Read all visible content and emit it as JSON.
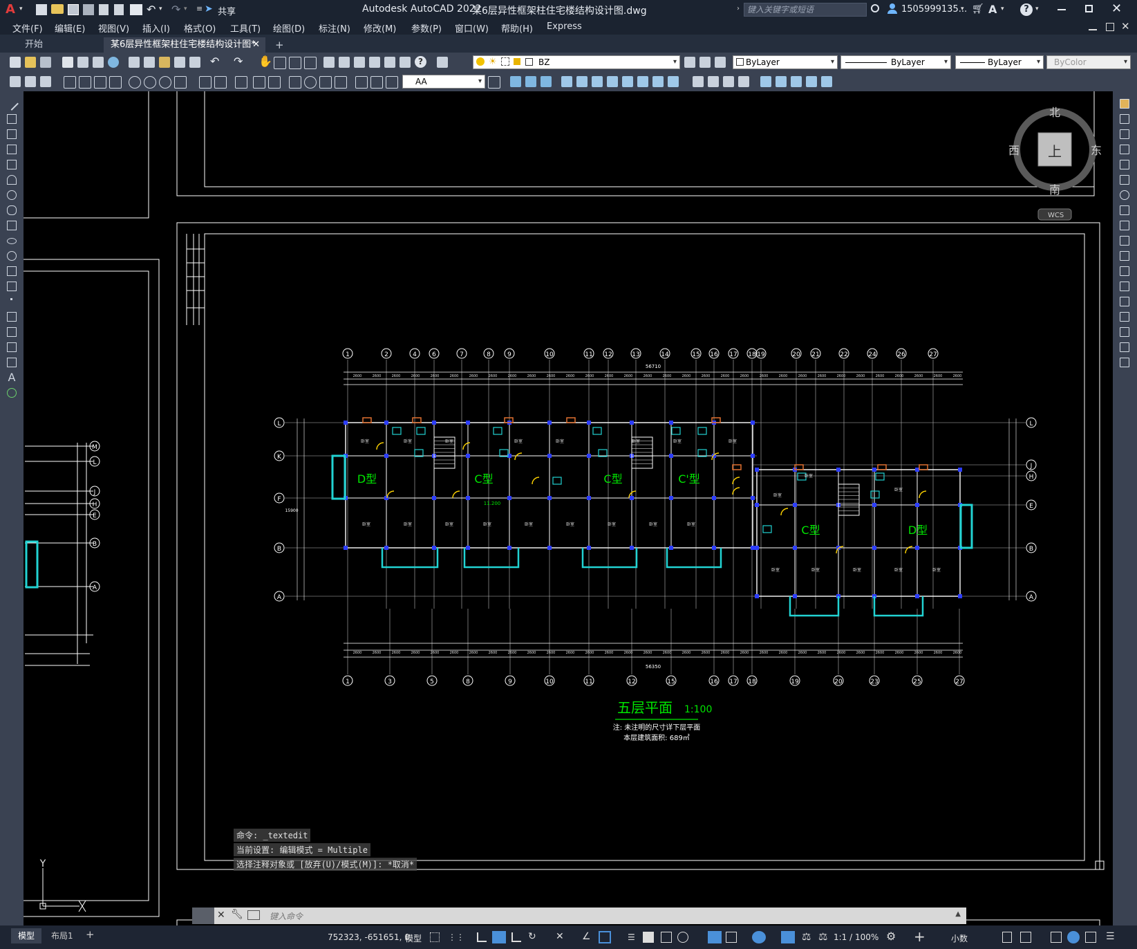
{
  "titlebar": {
    "app_title": "Autodesk AutoCAD 2022",
    "file_title": "某6层异性框架柱住宅楼结构设计图.dwg",
    "share": "共享",
    "search_placeholder": "键入关键字或短语",
    "user": "1505999135...",
    "help": "?"
  },
  "menus": [
    "文件(F)",
    "编辑(E)",
    "视图(V)",
    "插入(I)",
    "格式(O)",
    "工具(T)",
    "绘图(D)",
    "标注(N)",
    "修改(M)",
    "参数(P)",
    "窗口(W)",
    "帮助(H)",
    "Express"
  ],
  "tabs": {
    "start": "开始",
    "doc": "某6层异性框架柱住宅楼结构设计图*",
    "add": "+"
  },
  "toolbar": {
    "layer_value": "BZ",
    "color_value": "ByLayer",
    "linetype_value": "ByLayer",
    "lineweight_value": "ByLayer",
    "plotstyle_value": "ByColor",
    "textstyle_value": "AA"
  },
  "viewcube": {
    "north": "北",
    "south": "南",
    "east": "东",
    "west": "西",
    "top": "上",
    "wcs": "WCS"
  },
  "drawing": {
    "title": "五层平面",
    "scale": "1:100",
    "note1": "注: 未注明的尺寸详下层平面",
    "note2": "本层建筑面积: 689㎡",
    "types": [
      "D型",
      "C型",
      "C型",
      "C'型",
      "C型",
      "D型"
    ],
    "top_axes": [
      "1",
      "2",
      "4",
      "6",
      "7",
      "8",
      "9",
      "10",
      "11",
      "12",
      "13",
      "14",
      "15",
      "16",
      "17",
      "18",
      "19",
      "20",
      "21",
      "22",
      "24",
      "26",
      "27"
    ],
    "bottom_axes": [
      "1",
      "3",
      "5",
      "8",
      "9",
      "10",
      "11",
      "12",
      "15",
      "16",
      "17",
      "18",
      "19",
      "20",
      "23",
      "25",
      "27"
    ],
    "left_axes": [
      "L",
      "K",
      "F",
      "B",
      "A"
    ],
    "right_axes": [
      "L",
      "J",
      "H",
      "E",
      "B",
      "A"
    ],
    "left_partial_axes": [
      "M",
      "L",
      "J",
      "H",
      "E",
      "B",
      "A"
    ],
    "overall_dim_top": "56710",
    "overall_dim_bottom": "56350",
    "left_overall": "15900",
    "elev": "11.200",
    "y_axis_label": "Y"
  },
  "command": {
    "line1": "命令: _textedit",
    "line2": "当前设置: 编辑模式 = Multiple",
    "line3": "选择注释对象或 [放弃(U)/模式(M)]: *取消*",
    "placeholder": "键入命令"
  },
  "status": {
    "tab_model": "模型",
    "tab_layout": "布局1",
    "add": "+",
    "coords": "752323, -651651, 0",
    "space": "模型",
    "scale": "1:1 / 100%",
    "units": "小数"
  }
}
